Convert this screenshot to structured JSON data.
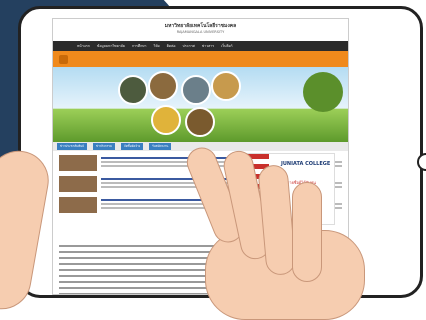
{
  "site": {
    "title": "มหาวิทยาลัยเทคโนโลยีราชมงคล",
    "subtitle": "RAJAMANGALA UNIVERSITY"
  },
  "topnav": [
    "หน้าแรก",
    "ข้อมูลมหาวิทยาลัย",
    "การศึกษา",
    "วิจัย",
    "ติดต่อ",
    "ประกาศ",
    "ข่าวสาร",
    "เว็บลิงก์"
  ],
  "subnav": [
    "ข่าวประชาสัมพันธ์",
    "ข่าวกิจกรรม",
    "จัดซื้อจัดจ้าง",
    "รับสมัครงาน"
  ],
  "ad": {
    "brand": "JUNIATA COLLEGE",
    "thai": "ประกาศรายชื่อผู้ได้รับทุน"
  }
}
